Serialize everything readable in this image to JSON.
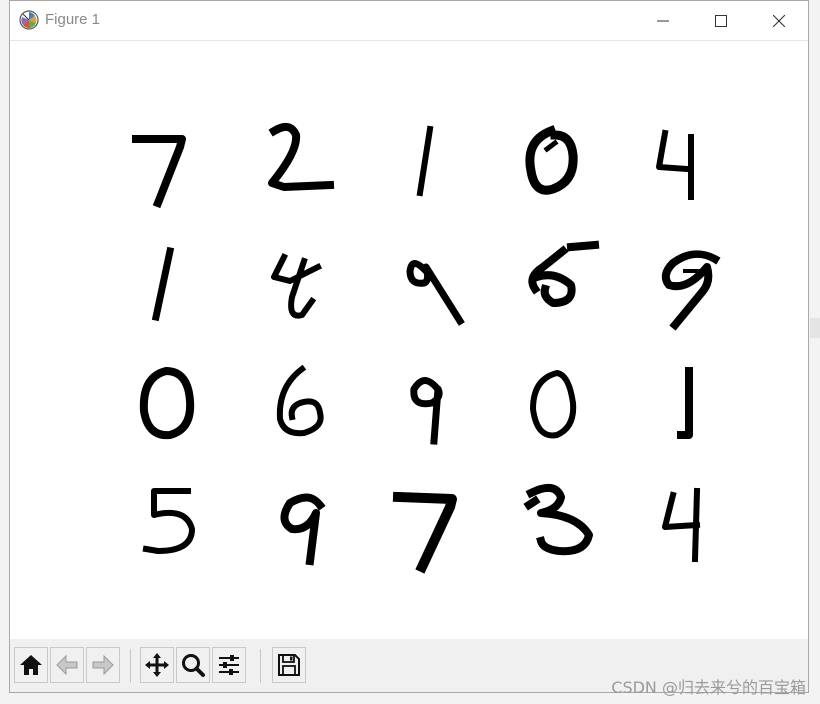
{
  "window": {
    "title": "Figure 1",
    "controls": [
      "minimize",
      "maximize",
      "close"
    ]
  },
  "figure": {
    "type": "image-grid",
    "rows": 4,
    "cols": 5,
    "digits": [
      [
        7,
        2,
        1,
        0,
        4
      ],
      [
        1,
        4,
        9,
        5,
        9
      ],
      [
        0,
        6,
        9,
        0,
        1
      ],
      [
        5,
        9,
        7,
        3,
        4
      ]
    ],
    "colormap": "gray_r"
  },
  "toolbar": {
    "buttons": [
      {
        "name": "home",
        "icon": "home-icon"
      },
      {
        "name": "back",
        "icon": "arrow-left-icon"
      },
      {
        "name": "forward",
        "icon": "arrow-right-icon"
      },
      {
        "name": "pan",
        "icon": "move-icon"
      },
      {
        "name": "zoom",
        "icon": "magnifier-icon"
      },
      {
        "name": "configure-subplots",
        "icon": "sliders-icon"
      },
      {
        "name": "save",
        "icon": "floppy-disk-icon"
      }
    ]
  },
  "watermark": {
    "text": "CSDN @归去来兮的百宝箱"
  }
}
